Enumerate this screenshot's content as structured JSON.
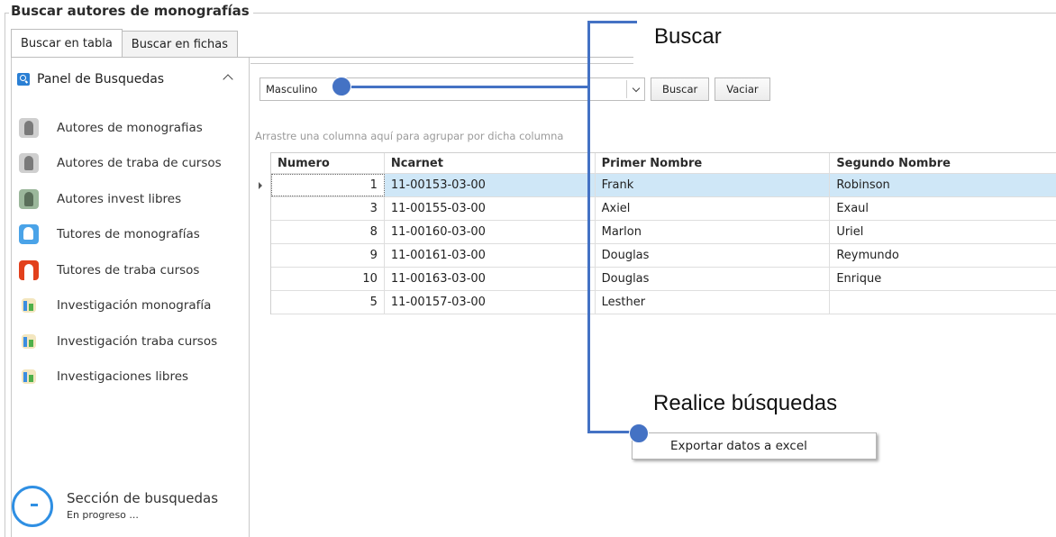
{
  "window": {
    "title": "Buscar autores de monografías"
  },
  "tabs": [
    {
      "label": "Buscar en tabla",
      "active": true
    },
    {
      "label": "Buscar en fichas",
      "active": false
    }
  ],
  "panel": {
    "title": "Panel de Busquedas",
    "items": [
      {
        "label": "Autores de monografias",
        "icon": "person-gray-icon"
      },
      {
        "label": "Autores de traba de cursos",
        "icon": "person-gray-icon"
      },
      {
        "label": "Autores invest libres",
        "icon": "person-green-icon"
      },
      {
        "label": "Tutores de monografías",
        "icon": "person-blue-icon"
      },
      {
        "label": "Tutores de traba cursos",
        "icon": "person-red-icon"
      },
      {
        "label": "Investigación monografía",
        "icon": "chart-icon"
      },
      {
        "label": "Investigación traba cursos",
        "icon": "chart-icon"
      },
      {
        "label": "Investigaciones libres",
        "icon": "chart-icon"
      }
    ],
    "status_title": "Sección de busquedas",
    "status_sub": "En progreso ..."
  },
  "search": {
    "combo_value": "Masculino",
    "search_label": "Buscar",
    "clear_label": "Vaciar"
  },
  "grid": {
    "group_hint": "Arrastre una columna aquí para agrupar por dicha columna",
    "columns": [
      "Numero",
      "Ncarnet",
      "Primer Nombre",
      "Segundo Nombre"
    ],
    "rows": [
      [
        "1",
        "11-00153-03-00",
        "Frank",
        "Robinson"
      ],
      [
        "3",
        "11-00155-03-00",
        "Axiel",
        "Exaul"
      ],
      [
        "8",
        "11-00160-03-00",
        "Marlon",
        "Uriel"
      ],
      [
        "9",
        "11-00161-03-00",
        "Douglas",
        "Reymundo"
      ],
      [
        "10",
        "11-00163-03-00",
        "Douglas",
        "Enrique"
      ],
      [
        "5",
        "11-00157-03-00",
        "Lesther",
        ""
      ]
    ],
    "selected_row": 0
  },
  "context_menu": {
    "export_label": "Exportar datos a excel"
  },
  "annotations": {
    "top": "Buscar",
    "bottom": "Realice búsquedas",
    "accent": "#4472c4"
  }
}
